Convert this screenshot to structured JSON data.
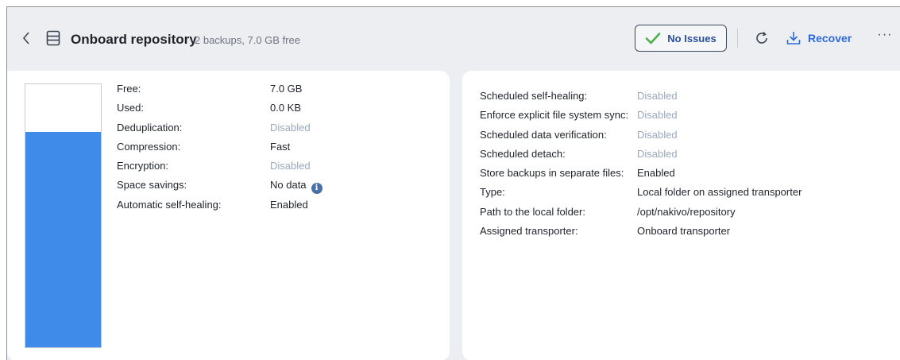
{
  "header": {
    "title": "Onboard repository",
    "subtitle": "2 backups, 7.0 GB free",
    "status_label": "No Issues",
    "recover_label": "Recover",
    "more_label": "···"
  },
  "icons": {
    "back": "chevron-left-icon",
    "repository": "repository-icon",
    "status": "checkmark-icon",
    "refresh": "refresh-icon",
    "recover": "download-icon",
    "info": "info-icon"
  },
  "colors": {
    "accent": "#2e6bd6",
    "usage_fill": "#3f8bea",
    "disabled_text": "#9aa8bd",
    "check_green": "#4caf50"
  },
  "usage": {
    "used_fraction": 0.82
  },
  "left_details": [
    {
      "key": "Free:",
      "value": "7.0 GB",
      "disabled": false
    },
    {
      "key": "Used:",
      "value": "0.0 KB",
      "disabled": false
    },
    {
      "key": "Deduplication:",
      "value": "Disabled",
      "disabled": true
    },
    {
      "key": "Compression:",
      "value": "Fast",
      "disabled": false
    },
    {
      "key": "Encryption:",
      "value": "Disabled",
      "disabled": true
    },
    {
      "key": "Space savings:",
      "value": "No data",
      "disabled": false,
      "info": true
    },
    {
      "key": "Automatic self-healing:",
      "value": "Enabled",
      "disabled": false
    }
  ],
  "right_details": [
    {
      "key": "Scheduled self-healing:",
      "value": "Disabled",
      "disabled": true
    },
    {
      "key": "Enforce explicit file system sync:",
      "value": "Disabled",
      "disabled": true
    },
    {
      "key": "Scheduled data verification:",
      "value": "Disabled",
      "disabled": true
    },
    {
      "key": "Scheduled detach:",
      "value": "Disabled",
      "disabled": true
    },
    {
      "key": "Store backups in separate files:",
      "value": "Enabled",
      "disabled": false
    },
    {
      "key": "Type:",
      "value": "Local folder on assigned transporter",
      "disabled": false
    },
    {
      "key": "Path to the local folder:",
      "value": "/opt/nakivo/repository",
      "disabled": false
    },
    {
      "key": "Assigned transporter:",
      "value": "Onboard transporter",
      "disabled": false
    }
  ]
}
